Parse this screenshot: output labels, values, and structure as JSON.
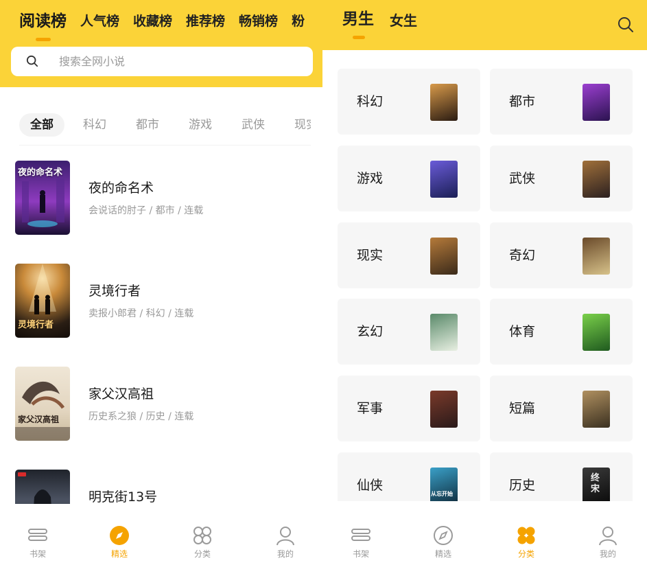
{
  "left_panel": {
    "rank_tabs": [
      "阅读榜",
      "人气榜",
      "收藏榜",
      "推荐榜",
      "畅销榜",
      "粉"
    ],
    "search": {
      "placeholder": "搜索全网小说"
    },
    "category_chips": [
      "全部",
      "科幻",
      "都市",
      "游戏",
      "武侠",
      "现实"
    ],
    "books": [
      {
        "title": "夜的命名术",
        "meta": "会说话的肘子 / 都市 / 连载",
        "cover_text": "夜的命名术",
        "colors": [
          "#3b1f6e",
          "#8e3bbf",
          "#1a1033"
        ]
      },
      {
        "title": "灵境行者",
        "meta": "卖报小郎君 / 科幻 / 连载",
        "cover_text": "灵境行者",
        "colors": [
          "#2a1e14",
          "#c98a3a",
          "#120c08"
        ]
      },
      {
        "title": "家父汉高祖",
        "meta": "历史系之狼 / 历史 / 连载",
        "cover_text": "家父汉高祖",
        "colors": [
          "#e9dfcf",
          "#8a5a3e",
          "#3a2a22"
        ]
      },
      {
        "title": "明克街13号",
        "meta": "",
        "cover_text": "",
        "colors": [
          "#3a3f4a",
          "#6b7382",
          "#1f232b"
        ]
      }
    ]
  },
  "left_nav": [
    {
      "label": "书架",
      "icon": "bookshelf-icon"
    },
    {
      "label": "精选",
      "icon": "compass-icon"
    },
    {
      "label": "分类",
      "icon": "category-icon"
    },
    {
      "label": "我的",
      "icon": "profile-icon"
    }
  ],
  "right_panel": {
    "gender_tabs": [
      "男生",
      "女生"
    ],
    "categories": [
      {
        "name": "科幻",
        "colors": [
          "#2a1b12",
          "#d89a4a"
        ]
      },
      {
        "name": "都市",
        "colors": [
          "#2b1350",
          "#9b3fd0"
        ]
      },
      {
        "name": "游戏",
        "colors": [
          "#1b1f55",
          "#6a5bd8"
        ]
      },
      {
        "name": "武侠",
        "colors": [
          "#2b2020",
          "#a0703a"
        ]
      },
      {
        "name": "现实",
        "colors": [
          "#3a2a1a",
          "#b57a3a"
        ]
      },
      {
        "name": "奇幻",
        "colors": [
          "#d7c28a",
          "#6a4a2a"
        ]
      },
      {
        "name": "玄幻",
        "colors": [
          "#e8efe2",
          "#5a8a6a"
        ]
      },
      {
        "name": "体育",
        "colors": [
          "#1f5a1f",
          "#7ad04a"
        ]
      },
      {
        "name": "军事",
        "colors": [
          "#2a1a1a",
          "#7a3a2a"
        ]
      },
      {
        "name": "短篇",
        "colors": [
          "#3a3020",
          "#b09060"
        ]
      },
      {
        "name": "仙侠",
        "colors": [
          "#0f2a3a",
          "#3aa0c8"
        ]
      },
      {
        "name": "历史",
        "colors": [
          "#0a0a0a",
          "#3a3a3a"
        ]
      }
    ],
    "cover_captions": {
      "xianxia": "从忘开始",
      "lishi": "终宋"
    }
  },
  "right_nav": [
    {
      "label": "书架",
      "icon": "bookshelf-icon"
    },
    {
      "label": "精选",
      "icon": "compass-icon"
    },
    {
      "label": "分类",
      "icon": "category-icon"
    },
    {
      "label": "我的",
      "icon": "profile-icon"
    }
  ],
  "theme": {
    "accent": "#f5a300",
    "header": "#fbd338"
  }
}
